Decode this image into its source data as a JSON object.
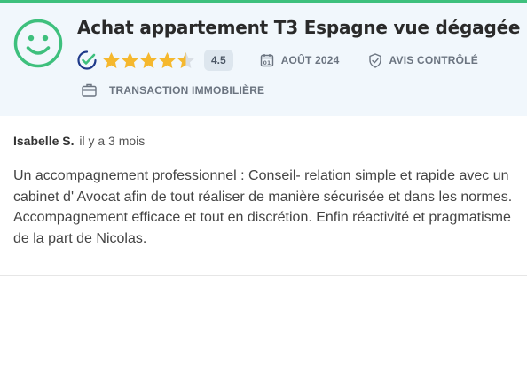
{
  "review": {
    "title": "Achat appartement T3 Espagne vue dégagée",
    "rating_value": "4.5",
    "rating": 4.5,
    "rating_max": 5,
    "date": "AOÛT 2024",
    "verification": "AVIS CONTRÔLÉ",
    "category": "TRANSACTION IMMOBILIÈRE",
    "author": "Isabelle S.",
    "posted": "il y a 3 mois",
    "text": "Un accompagnement professionnel : Conseil- relation simple et rapide avec un cabinet d' Avocat afin de tout réaliser de manière sécurisée et dans les normes. Accompagnement efficace et tout en discrétion. Enfin réactivité et pragmatisme de la part de Nicolas."
  },
  "icons": {
    "sentiment": "smiley-icon",
    "verified": "verified-check-icon",
    "date": "calendar-icon",
    "verification": "shield-check-icon",
    "category": "briefcase-icon"
  },
  "colors": {
    "accent_green": "#3ec07d",
    "star": "#f5b82e",
    "header_bg": "#f1f7fc",
    "verified_blue": "#1f3a8a"
  }
}
